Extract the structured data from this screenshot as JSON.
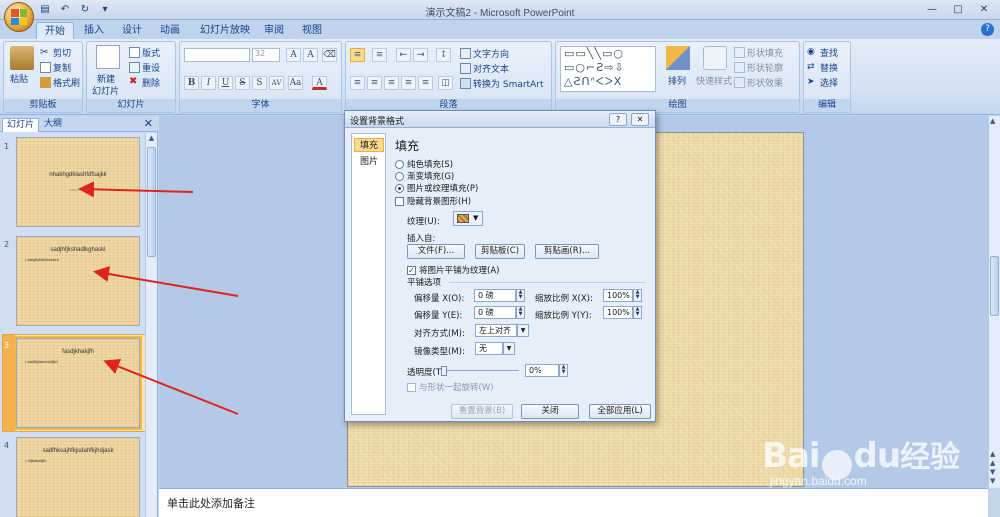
{
  "window": {
    "title": "演示文稿2 - Microsoft PowerPoint"
  },
  "tabs": [
    "开始",
    "插入",
    "设计",
    "动画",
    "幻灯片放映",
    "审阅",
    "视图"
  ],
  "ribbon": {
    "clipboard": {
      "paste": "粘贴",
      "cut": "剪切",
      "copy": "复制",
      "format_painter": "格式刷",
      "label": "剪贴板"
    },
    "slides": {
      "new_slide_1": "新建",
      "new_slide_2": "幻灯片",
      "layout": "版式",
      "reset": "重设",
      "delete": "删除",
      "label": "幻灯片"
    },
    "font": {
      "size": "32",
      "label": "字体"
    },
    "paragraph": {
      "text_direction": "文字方向",
      "align_text": "对齐文本",
      "smartart": "转换为 SmartArt",
      "label": "段落"
    },
    "drawing": {
      "arrange": "排列",
      "quick_styles": "快速样式",
      "shape_fill": "形状填充",
      "shape_outline": "形状轮廓",
      "shape_effects": "形状效果",
      "label": "绘图"
    },
    "editing": {
      "find": "查找",
      "replace": "替换",
      "select": "选择",
      "label": "编辑"
    }
  },
  "panel": {
    "tab_slides": "幻灯片",
    "tab_outline": "大纲",
    "slides": [
      {
        "num": "1",
        "title": "nhakhgdklashfdfsajkk",
        "sub": "fasfdsafdsaf"
      },
      {
        "num": "2",
        "title": "sadjhfjkshadlkghaskl",
        "bullet": "• ahsjfkdsfkldasklnl"
      },
      {
        "num": "3",
        "title": "fasdjkhakjfh",
        "bullet": "• sadfkjlasnvsdfjkh"
      },
      {
        "num": "4",
        "title": "sadfhksajhfkjsdahfkjhdjask",
        "bullet": "• nfjkasndjfh"
      }
    ]
  },
  "notes_placeholder": "单击此处添加备注",
  "dialog": {
    "title": "设置背景格式",
    "side_fill": "填充",
    "side_picture": "图片",
    "heading": "填充",
    "solid_fill": "纯色填充(S)",
    "gradient_fill": "渐变填充(G)",
    "picture_fill": "图片或纹理填充(P)",
    "hide_bg": "隐藏背景图形(H)",
    "texture_label": "纹理(U):",
    "insert_from": "插入自:",
    "btn_file": "文件(F)...",
    "btn_clipboard": "剪贴板(C)",
    "btn_clipart": "剪贴画(R)...",
    "tile_as_texture": "将图片平铺为纹理(A)",
    "tiling_options": "平铺选项",
    "offset_x_label": "偏移量 X(O):",
    "offset_x_value": "0 磅",
    "scale_x_label": "缩放比例 X(X):",
    "scale_x_value": "100%",
    "offset_y_label": "偏移量 Y(E):",
    "offset_y_value": "0 磅",
    "scale_y_label": "缩放比例 Y(Y):",
    "scale_y_value": "100%",
    "alignment_label": "对齐方式(M):",
    "alignment_value": "左上对齐",
    "mirror_label": "镜像类型(M):",
    "mirror_value": "无",
    "transparency_label": "透明度(T):",
    "transparency_value": "0%",
    "rotate_with_shape": "与形状一起旋转(W)",
    "btn_reset": "重置背景(B)",
    "btn_close": "关闭",
    "btn_apply_all": "全部应用(L)"
  },
  "watermark": {
    "brand": "Bai",
    "brand2": "du",
    "jingyan": "经验",
    "url": "jingyan.baidu.com"
  },
  "colors": {
    "arrow": "#e0241b",
    "accent": "#15428b",
    "selection": "#f3b649"
  }
}
